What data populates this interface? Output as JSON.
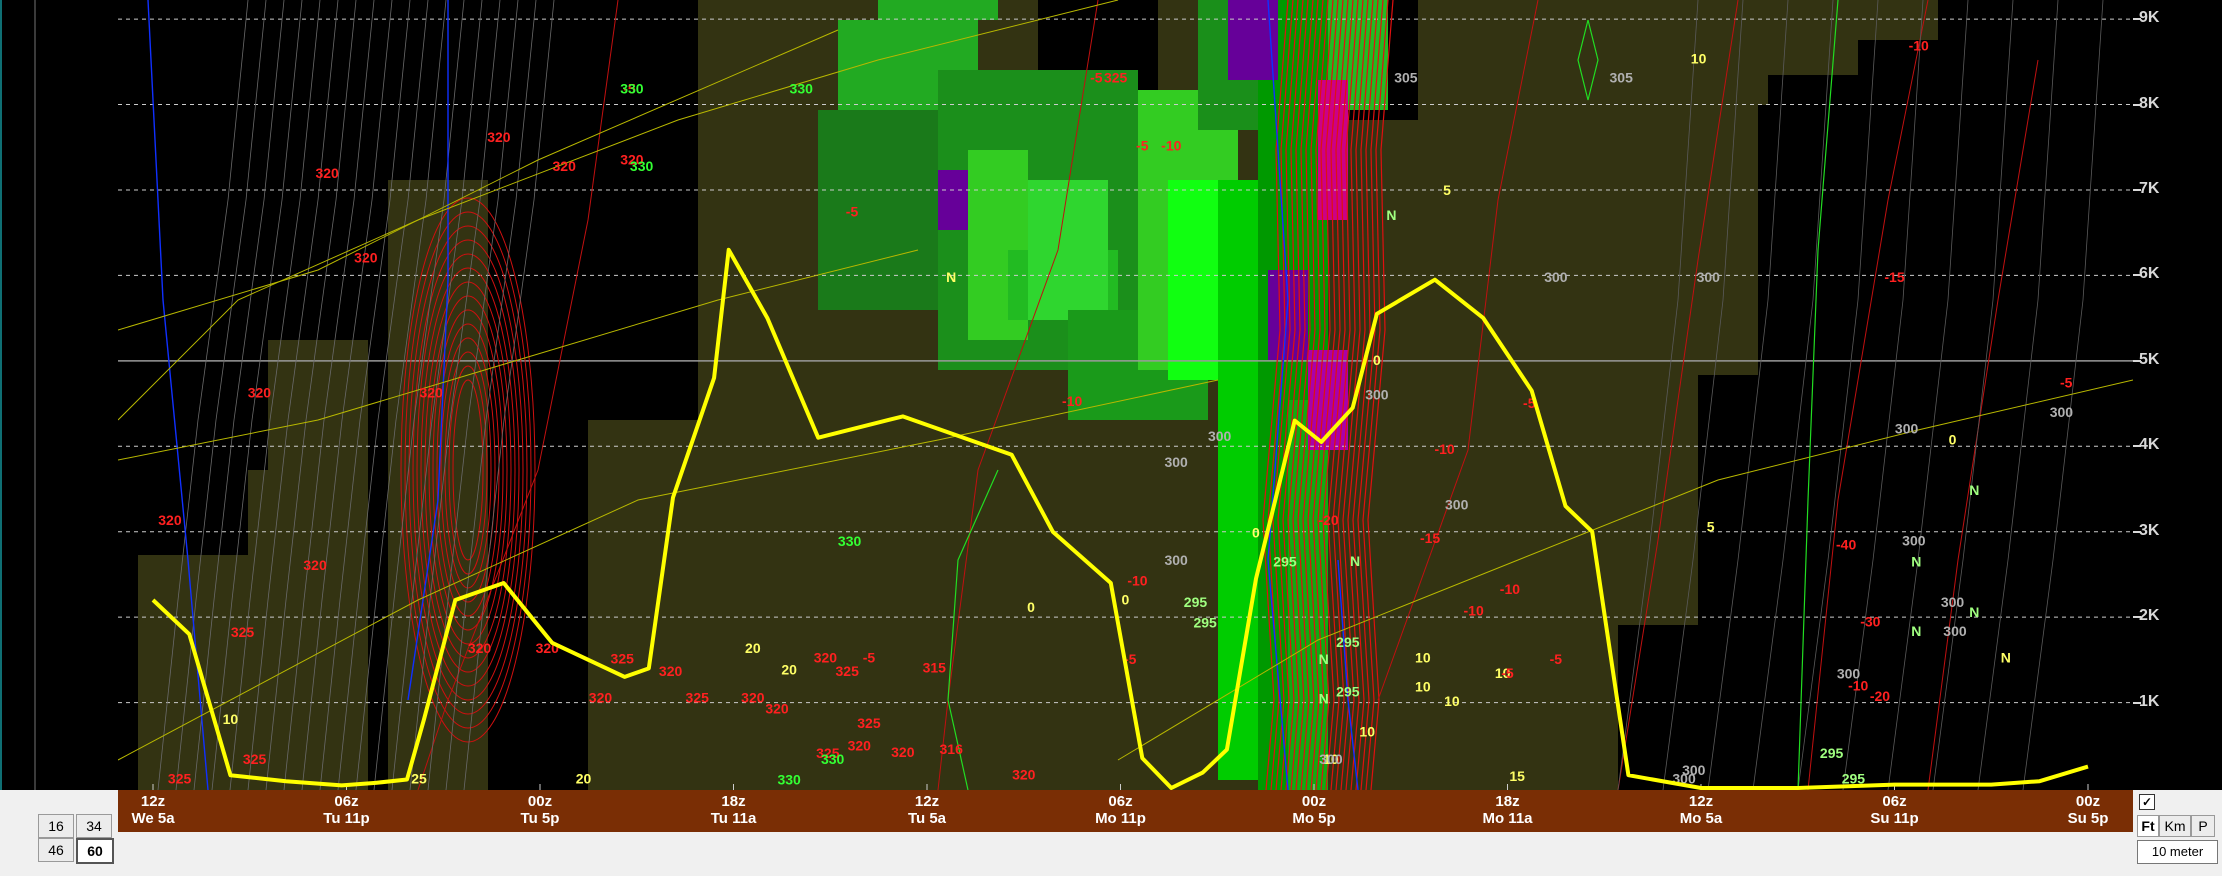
{
  "chart_data": {
    "type": "line",
    "title": "",
    "xlabel": "",
    "ylabel": "",
    "x_reversed": true,
    "x_ticks": [
      {
        "line1": "12z",
        "line2": "We 5a"
      },
      {
        "line1": "06z",
        "line2": "Tu 11p"
      },
      {
        "line1": "00z",
        "line2": "Tu 5p"
      },
      {
        "line1": "18z",
        "line2": "Tu 11a"
      },
      {
        "line1": "12z",
        "line2": "Tu 5a"
      },
      {
        "line1": "06z",
        "line2": "Mo 11p"
      },
      {
        "line1": "00z",
        "line2": "Mo 5p"
      },
      {
        "line1": "18z",
        "line2": "Mo 11a"
      },
      {
        "line1": "12z",
        "line2": "Mo 5a"
      },
      {
        "line1": "06z",
        "line2": "Su 11p"
      },
      {
        "line1": "00z",
        "line2": "Su 5p"
      }
    ],
    "y_ticks": [
      "1K",
      "2K",
      "3K",
      "4K",
      "5K",
      "6K",
      "7K",
      "8K",
      "9K"
    ],
    "ylim": [
      0,
      9200
    ],
    "xlim": [
      0,
      80
    ],
    "grid": true,
    "series": [
      {
        "color": "#ffff00",
        "x": [
          0,
          1.5,
          3.2,
          5.5,
          7.8,
          9.2,
          10.5,
          11.2,
          12.5,
          14.5,
          16.5,
          19.5,
          20.5,
          21.5,
          23.2,
          23.8,
          25.4,
          27.5,
          31,
          35.5,
          37.2,
          39.6,
          40.9,
          42.1,
          43.4,
          44.4,
          45.6,
          47.2,
          48.3,
          49.6,
          50.6,
          53,
          55,
          57,
          58.4,
          59.5,
          61,
          64,
          68,
          72,
          76,
          78,
          80
        ],
        "y": [
          2200,
          1800,
          150,
          80,
          30,
          60,
          100,
          800,
          2200,
          2400,
          1700,
          1300,
          1400,
          3400,
          4800,
          6300,
          5500,
          4100,
          4350,
          3900,
          3000,
          2400,
          350,
          0,
          180,
          450,
          2450,
          4300,
          4050,
          4450,
          5550,
          5950,
          5500,
          4650,
          3300,
          3000,
          150,
          0,
          0,
          40,
          40,
          80,
          250
        ]
      }
    ],
    "contour_labels": [
      {
        "text": "10",
        "color": "#ffff66",
        "x": 63.9,
        "y": 8480
      },
      {
        "text": "5",
        "color": "#ffff66",
        "x": 53.5,
        "y": 6940
      },
      {
        "text": "0",
        "color": "#ffff66",
        "x": 50.6,
        "y": 4950
      },
      {
        "text": "0",
        "color": "#ffff66",
        "x": 74.4,
        "y": 4020
      },
      {
        "text": "5",
        "color": "#ffff66",
        "x": 64.4,
        "y": 3000
      },
      {
        "text": "0",
        "color": "#ffff66",
        "x": 45.6,
        "y": 2930
      },
      {
        "text": "10",
        "color": "#ffff66",
        "x": 52.5,
        "y": 1470
      },
      {
        "text": "20",
        "color": "#ffff66",
        "x": 24.8,
        "y": 1580
      },
      {
        "text": "20",
        "color": "#ffff66",
        "x": 26.3,
        "y": 1330
      },
      {
        "text": "10",
        "color": "#ffff66",
        "x": 55.8,
        "y": 1290
      },
      {
        "text": "10",
        "color": "#ffff66",
        "x": 52.5,
        "y": 1130
      },
      {
        "text": "10",
        "color": "#ffff66",
        "x": 53.7,
        "y": 960
      },
      {
        "text": "10",
        "color": "#ffff66",
        "x": 50.2,
        "y": 600
      },
      {
        "text": "10",
        "color": "#ffff66",
        "x": 48.7,
        "y": 280
      },
      {
        "text": "15",
        "color": "#ffff66",
        "x": 56.4,
        "y": 80
      },
      {
        "text": "0",
        "color": "#ffff66",
        "x": 36.3,
        "y": 2060
      },
      {
        "text": "0",
        "color": "#ffff66",
        "x": 40.2,
        "y": 2150
      },
      {
        "text": "10",
        "color": "#ffff66",
        "x": 3.2,
        "y": 750
      },
      {
        "text": "25",
        "color": "#ffff66",
        "x": 11,
        "y": 50
      },
      {
        "text": "20",
        "color": "#ffff66",
        "x": 17.8,
        "y": 50
      },
      {
        "text": "N",
        "color": "#ffff66",
        "x": 33,
        "y": 5920
      },
      {
        "text": "N",
        "color": "#ffff66",
        "x": 76.6,
        "y": 1470
      },
      {
        "text": "-10",
        "color": "#ff2020",
        "x": 73,
        "y": 8630
      },
      {
        "text": "-5",
        "color": "#ff2020",
        "x": 79.1,
        "y": 4690
      },
      {
        "text": "-15",
        "color": "#ff2020",
        "x": 72,
        "y": 5920
      },
      {
        "text": "-10",
        "color": "#ff2020",
        "x": 70.5,
        "y": 1140
      },
      {
        "text": "-40",
        "color": "#ff2020",
        "x": 70,
        "y": 2790
      },
      {
        "text": "-30",
        "color": "#ff2020",
        "x": 71,
        "y": 1890
      },
      {
        "text": "-20",
        "color": "#ff2020",
        "x": 71.4,
        "y": 1020
      },
      {
        "text": "-5",
        "color": "#ff2020",
        "x": 56.9,
        "y": 4450
      },
      {
        "text": "-10",
        "color": "#ff2020",
        "x": 53.4,
        "y": 3910
      },
      {
        "text": "-15",
        "color": "#ff2020",
        "x": 52.8,
        "y": 2870
      },
      {
        "text": "-20",
        "color": "#ff2020",
        "x": 48.6,
        "y": 3080
      },
      {
        "text": "-10",
        "color": "#ff2020",
        "x": 56.1,
        "y": 2270
      },
      {
        "text": "-10",
        "color": "#ff2020",
        "x": 54.6,
        "y": 2020
      },
      {
        "text": "-5",
        "color": "#ff2020",
        "x": 58,
        "y": 1450
      },
      {
        "text": "-5",
        "color": "#ff2020",
        "x": 56,
        "y": 1290
      },
      {
        "text": "-5",
        "color": "#ff2020",
        "x": 40.4,
        "y": 1450
      },
      {
        "text": "-10",
        "color": "#ff2020",
        "x": 40.7,
        "y": 2370
      },
      {
        "text": "-10",
        "color": "#ff2020",
        "x": 38,
        "y": 4470
      },
      {
        "text": "-5",
        "color": "#ff2020",
        "x": 40.9,
        "y": 7460
      },
      {
        "text": "-10",
        "color": "#ff2020",
        "x": 42.1,
        "y": 7460
      },
      {
        "text": "325",
        "color": "#ff2020",
        "x": 39.8,
        "y": 8260
      },
      {
        "text": "-5",
        "color": "#ff2020",
        "x": 39,
        "y": 8260
      },
      {
        "text": "-5",
        "color": "#ff2020",
        "x": 28.9,
        "y": 6690
      },
      {
        "text": "-5",
        "color": "#ff2020",
        "x": 29.6,
        "y": 1470
      },
      {
        "text": "320",
        "color": "#ff2020",
        "x": 19.8,
        "y": 7300
      },
      {
        "text": "320",
        "color": "#ff2020",
        "x": 14.3,
        "y": 7560
      },
      {
        "text": "320",
        "color": "#ff2020",
        "x": 17,
        "y": 7220
      },
      {
        "text": "320",
        "color": "#ff2020",
        "x": 7.2,
        "y": 7140
      },
      {
        "text": "320",
        "color": "#ff2020",
        "x": 8.8,
        "y": 6150
      },
      {
        "text": "320",
        "color": "#ff2020",
        "x": 11.5,
        "y": 4570
      },
      {
        "text": "320",
        "color": "#ff2020",
        "x": 4.4,
        "y": 4570
      },
      {
        "text": "320",
        "color": "#ff2020",
        "x": 0.7,
        "y": 3080
      },
      {
        "text": "320",
        "color": "#ff2020",
        "x": 6.7,
        "y": 2550
      },
      {
        "text": "325",
        "color": "#ff2020",
        "x": 3.7,
        "y": 1770
      },
      {
        "text": "320",
        "color": "#ff2020",
        "x": 13.5,
        "y": 1580
      },
      {
        "text": "320",
        "color": "#ff2020",
        "x": 16.3,
        "y": 1580
      },
      {
        "text": "325",
        "color": "#ff2020",
        "x": 19.4,
        "y": 1460
      },
      {
        "text": "320",
        "color": "#ff2020",
        "x": 27.8,
        "y": 1470
      },
      {
        "text": "320",
        "color": "#ff2020",
        "x": 21.4,
        "y": 1310
      },
      {
        "text": "320",
        "color": "#ff2020",
        "x": 18.5,
        "y": 1000
      },
      {
        "text": "325",
        "color": "#ff2020",
        "x": 22.5,
        "y": 1000
      },
      {
        "text": "320",
        "color": "#ff2020",
        "x": 24.8,
        "y": 1000
      },
      {
        "text": "325",
        "color": "#ff2020",
        "x": 28.7,
        "y": 1310
      },
      {
        "text": "320",
        "color": "#ff2020",
        "x": 25.8,
        "y": 870
      },
      {
        "text": "315",
        "color": "#ff2020",
        "x": 32.3,
        "y": 1350
      },
      {
        "text": "320",
        "color": "#ff2020",
        "x": 36,
        "y": 100
      },
      {
        "text": "325",
        "color": "#ff2020",
        "x": 4.2,
        "y": 280
      },
      {
        "text": "325",
        "color": "#ff2020",
        "x": 1.1,
        "y": 50
      },
      {
        "text": "325",
        "color": "#ff2020",
        "x": 29.6,
        "y": 700
      },
      {
        "text": "320",
        "color": "#ff2020",
        "x": 29.2,
        "y": 440
      },
      {
        "text": "316",
        "color": "#ff2020",
        "x": 33,
        "y": 400
      },
      {
        "text": "320",
        "color": "#ff2020",
        "x": 31,
        "y": 360
      },
      {
        "text": "325",
        "color": "#ff2020",
        "x": 27.9,
        "y": 350
      },
      {
        "text": "-5",
        "color": "#ff2020",
        "x": 19.7,
        "y": 8130
      },
      {
        "text": "300",
        "color": "#b0b0b0",
        "x": 50.6,
        "y": 4550
      },
      {
        "text": "300",
        "color": "#b0b0b0",
        "x": 42.3,
        "y": 3760
      },
      {
        "text": "300",
        "color": "#b0b0b0",
        "x": 44.1,
        "y": 4060
      },
      {
        "text": "300",
        "color": "#b0b0b0",
        "x": 53.9,
        "y": 3260
      },
      {
        "text": "300",
        "color": "#b0b0b0",
        "x": 72.5,
        "y": 4150
      },
      {
        "text": "300",
        "color": "#b0b0b0",
        "x": 72.8,
        "y": 2840
      },
      {
        "text": "300",
        "color": "#b0b0b0",
        "x": 74.4,
        "y": 2120
      },
      {
        "text": "300",
        "color": "#b0b0b0",
        "x": 74.5,
        "y": 1780
      },
      {
        "text": "300",
        "color": "#b0b0b0",
        "x": 70.1,
        "y": 1280
      },
      {
        "text": "300",
        "color": "#b0b0b0",
        "x": 78.9,
        "y": 4340
      },
      {
        "text": "300",
        "color": "#b0b0b0",
        "x": 64.3,
        "y": 5920
      },
      {
        "text": "300",
        "color": "#b0b0b0",
        "x": 42.3,
        "y": 2610
      },
      {
        "text": "300",
        "color": "#b0b0b0",
        "x": 58,
        "y": 5920
      },
      {
        "text": "300",
        "color": "#b0b0b0",
        "x": 48.7,
        "y": 280
      },
      {
        "text": "300",
        "color": "#b0b0b0",
        "x": 63.7,
        "y": 150
      },
      {
        "text": "300",
        "color": "#b0b0b0",
        "x": 63.3,
        "y": 50
      },
      {
        "text": "305",
        "color": "#b0b0b0",
        "x": 51.8,
        "y": 8260
      },
      {
        "text": "305",
        "color": "#b0b0b0",
        "x": 60.7,
        "y": 8260
      },
      {
        "text": "330",
        "color": "#33ff33",
        "x": 26.8,
        "y": 8130
      },
      {
        "text": "330",
        "color": "#33ff33",
        "x": 19.8,
        "y": 8130
      },
      {
        "text": "330",
        "color": "#33ff33",
        "x": 20.2,
        "y": 7220
      },
      {
        "text": "330",
        "color": "#33ff33",
        "x": 28.8,
        "y": 2830
      },
      {
        "text": "330",
        "color": "#33ff33",
        "x": 28.1,
        "y": 280
      },
      {
        "text": "330",
        "color": "#33ff33",
        "x": 26.3,
        "y": 40
      },
      {
        "text": "295",
        "color": "#a0ff80",
        "x": 46.8,
        "y": 2590
      },
      {
        "text": "295",
        "color": "#a0ff80",
        "x": 49.4,
        "y": 1650
      },
      {
        "text": "295",
        "color": "#a0ff80",
        "x": 49.4,
        "y": 1070
      },
      {
        "text": "295",
        "color": "#a0ff80",
        "x": 43.1,
        "y": 2120
      },
      {
        "text": "295",
        "color": "#a0ff80",
        "x": 43.5,
        "y": 1880
      },
      {
        "text": "295",
        "color": "#a0ff80",
        "x": 69.4,
        "y": 350
      },
      {
        "text": "295",
        "color": "#a0ff80",
        "x": 70.3,
        "y": 50
      },
      {
        "text": "N",
        "color": "#a0ff80",
        "x": 51.2,
        "y": 6650
      },
      {
        "text": "N",
        "color": "#a0ff80",
        "x": 75.3,
        "y": 3430
      },
      {
        "text": "N",
        "color": "#a0ff80",
        "x": 72.9,
        "y": 2590
      },
      {
        "text": "N",
        "color": "#a0ff80",
        "x": 75.3,
        "y": 2000
      },
      {
        "text": "N",
        "color": "#a0ff80",
        "x": 72.9,
        "y": 1780
      },
      {
        "text": "N",
        "color": "#a0ff80",
        "x": 48.4,
        "y": 1450
      },
      {
        "text": "N",
        "color": "#a0ff80",
        "x": 48.4,
        "y": 990
      },
      {
        "text": "N",
        "color": "#a0ff80",
        "x": 49.7,
        "y": 2600
      }
    ]
  },
  "controls": {
    "run_buttons": [
      "16",
      "34",
      "46",
      "60"
    ],
    "active_run": "60",
    "units": [
      "Ft",
      "Km",
      "P"
    ],
    "active_unit": "Ft",
    "check_mark": "✓",
    "level": "10 meter"
  }
}
